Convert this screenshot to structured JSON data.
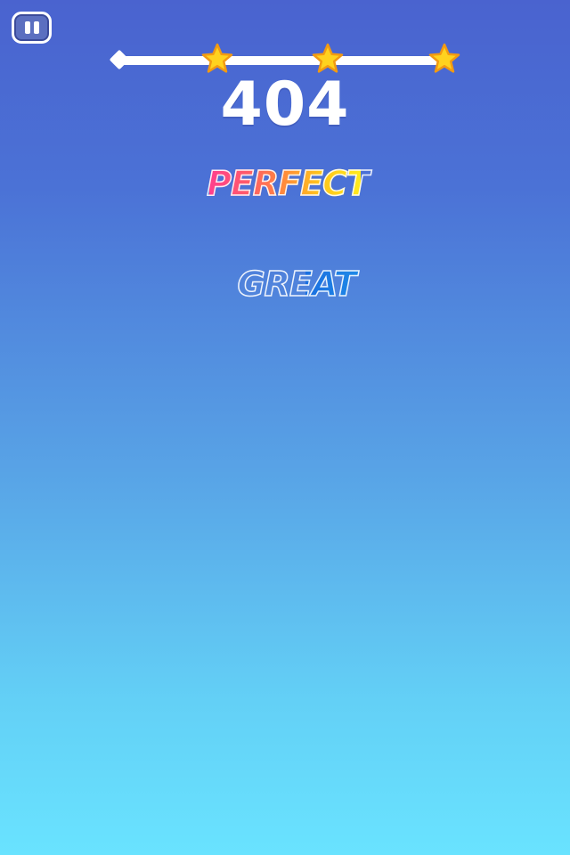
{
  "hud": {
    "pause_icon": "pause-icon",
    "score": "404",
    "progress": {
      "fraction": 0.02,
      "stars": [
        {
          "name": "star-icon",
          "filled": true
        },
        {
          "name": "star-icon",
          "filled": true
        },
        {
          "name": "star-icon",
          "filled": true
        }
      ]
    }
  },
  "feedback": {
    "perfect": "PERFECT",
    "great": "GREAT"
  },
  "colors": {
    "background_top": "#4a63cf",
    "background_bottom": "#69e3ff",
    "star_fill": "#ffd21f",
    "star_outline": "#f29a12",
    "perfect_gradient": [
      "#ff3f8e",
      "#ff8c3a",
      "#ffeb1c"
    ],
    "great_gradient": [
      "#1a6fe0",
      "#26c0f2"
    ]
  }
}
